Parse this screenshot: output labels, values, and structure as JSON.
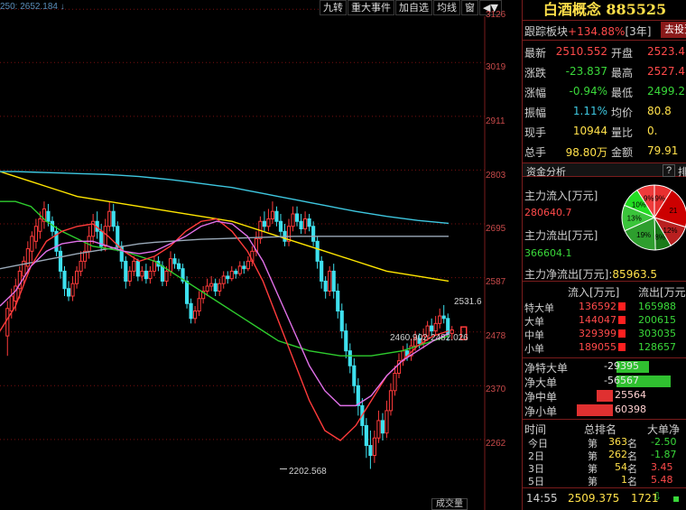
{
  "toolbar": {
    "zoom_text": "250: 2652.184 ↓",
    "items": [
      "九转",
      "重大事件",
      "加自选",
      "均线",
      "窗",
      "◀▼"
    ]
  },
  "y_axis": [
    "3126",
    "3019",
    "2911",
    "2803",
    "2695",
    "2587",
    "2478",
    "2370",
    "2262"
  ],
  "annotations": {
    "high_label": "2531.6",
    "last_value": "2460.902-2482.026",
    "low_label": "2202.568",
    "volume_tab": "成交量"
  },
  "chart_data": {
    "type": "candlestick",
    "ylim": [
      2202,
      3130
    ],
    "y_ticks": [
      3126,
      3019,
      2911,
      2803,
      2695,
      2587,
      2478,
      2370,
      2262
    ],
    "candles": [
      [
        2470,
        2525,
        2430,
        2540
      ],
      [
        2520,
        2550,
        2505,
        2565
      ],
      [
        2540,
        2570,
        2520,
        2585
      ],
      [
        2565,
        2600,
        2545,
        2610
      ],
      [
        2590,
        2620,
        2575,
        2630
      ],
      [
        2610,
        2645,
        2595,
        2660
      ],
      [
        2640,
        2670,
        2620,
        2680
      ],
      [
        2660,
        2690,
        2645,
        2705
      ],
      [
        2680,
        2705,
        2665,
        2720
      ],
      [
        2700,
        2725,
        2685,
        2740
      ],
      [
        2720,
        2700,
        2690,
        2735
      ],
      [
        2700,
        2680,
        2670,
        2710
      ],
      [
        2680,
        2640,
        2630,
        2690
      ],
      [
        2640,
        2600,
        2585,
        2650
      ],
      [
        2600,
        2565,
        2550,
        2610
      ],
      [
        2565,
        2550,
        2540,
        2580
      ],
      [
        2550,
        2575,
        2540,
        2590
      ],
      [
        2575,
        2600,
        2565,
        2610
      ],
      [
        2600,
        2620,
        2590,
        2640
      ],
      [
        2620,
        2640,
        2605,
        2660
      ],
      [
        2640,
        2670,
        2625,
        2690
      ],
      [
        2670,
        2700,
        2655,
        2715
      ],
      [
        2700,
        2680,
        2665,
        2720
      ],
      [
        2680,
        2650,
        2640,
        2695
      ],
      [
        2650,
        2690,
        2640,
        2705
      ],
      [
        2690,
        2720,
        2680,
        2740
      ],
      [
        2720,
        2690,
        2680,
        2735
      ],
      [
        2690,
        2650,
        2640,
        2700
      ],
      [
        2650,
        2620,
        2605,
        2660
      ],
      [
        2620,
        2580,
        2565,
        2630
      ],
      [
        2580,
        2600,
        2570,
        2610
      ],
      [
        2600,
        2620,
        2590,
        2630
      ],
      [
        2620,
        2590,
        2580,
        2625
      ],
      [
        2590,
        2600,
        2580,
        2610
      ],
      [
        2600,
        2585,
        2575,
        2615
      ],
      [
        2585,
        2600,
        2575,
        2610
      ],
      [
        2600,
        2620,
        2590,
        2630
      ],
      [
        2620,
        2610,
        2600,
        2630
      ],
      [
        2610,
        2580,
        2570,
        2620
      ],
      [
        2580,
        2600,
        2570,
        2610
      ],
      [
        2600,
        2625,
        2590,
        2640
      ],
      [
        2625,
        2615,
        2605,
        2635
      ],
      [
        2615,
        2605,
        2600,
        2625
      ],
      [
        2605,
        2580,
        2575,
        2615
      ],
      [
        2580,
        2535,
        2525,
        2590
      ],
      [
        2535,
        2505,
        2495,
        2545
      ],
      [
        2505,
        2520,
        2495,
        2530
      ],
      [
        2520,
        2545,
        2510,
        2560
      ],
      [
        2545,
        2560,
        2535,
        2570
      ],
      [
        2560,
        2570,
        2550,
        2585
      ],
      [
        2570,
        2575,
        2560,
        2590
      ],
      [
        2575,
        2560,
        2550,
        2585
      ],
      [
        2560,
        2575,
        2550,
        2585
      ],
      [
        2575,
        2590,
        2565,
        2600
      ],
      [
        2590,
        2585,
        2575,
        2600
      ],
      [
        2585,
        2600,
        2580,
        2610
      ],
      [
        2600,
        2595,
        2585,
        2605
      ],
      [
        2595,
        2610,
        2590,
        2620
      ],
      [
        2610,
        2605,
        2595,
        2620
      ],
      [
        2605,
        2620,
        2600,
        2630
      ],
      [
        2620,
        2640,
        2610,
        2650
      ],
      [
        2640,
        2665,
        2630,
        2680
      ],
      [
        2665,
        2700,
        2655,
        2710
      ],
      [
        2700,
        2690,
        2680,
        2720
      ],
      [
        2690,
        2705,
        2680,
        2725
      ],
      [
        2705,
        2720,
        2695,
        2740
      ],
      [
        2720,
        2700,
        2690,
        2730
      ],
      [
        2700,
        2680,
        2670,
        2715
      ],
      [
        2680,
        2660,
        2650,
        2695
      ],
      [
        2660,
        2690,
        2650,
        2705
      ],
      [
        2690,
        2715,
        2680,
        2730
      ],
      [
        2715,
        2700,
        2690,
        2730
      ],
      [
        2700,
        2685,
        2675,
        2715
      ],
      [
        2685,
        2705,
        2675,
        2720
      ],
      [
        2705,
        2690,
        2680,
        2715
      ],
      [
        2690,
        2660,
        2650,
        2700
      ],
      [
        2660,
        2620,
        2605,
        2670
      ],
      [
        2620,
        2580,
        2565,
        2630
      ],
      [
        2580,
        2560,
        2545,
        2590
      ],
      [
        2560,
        2600,
        2550,
        2610
      ],
      [
        2600,
        2560,
        2545,
        2615
      ],
      [
        2560,
        2520,
        2505,
        2575
      ],
      [
        2520,
        2480,
        2465,
        2535
      ],
      [
        2480,
        2440,
        2425,
        2495
      ],
      [
        2440,
        2410,
        2395,
        2455
      ],
      [
        2410,
        2370,
        2355,
        2425
      ],
      [
        2370,
        2330,
        2310,
        2385
      ],
      [
        2330,
        2290,
        2270,
        2345
      ],
      [
        2290,
        2250,
        2225,
        2305
      ],
      [
        2250,
        2230,
        2203,
        2280
      ],
      [
        2230,
        2265,
        2215,
        2280
      ],
      [
        2265,
        2300,
        2255,
        2320
      ],
      [
        2300,
        2275,
        2260,
        2315
      ],
      [
        2275,
        2320,
        2265,
        2340
      ],
      [
        2320,
        2360,
        2310,
        2375
      ],
      [
        2360,
        2395,
        2350,
        2410
      ],
      [
        2395,
        2420,
        2385,
        2435
      ],
      [
        2420,
        2440,
        2410,
        2450
      ],
      [
        2440,
        2430,
        2420,
        2455
      ],
      [
        2430,
        2450,
        2420,
        2465
      ],
      [
        2450,
        2465,
        2440,
        2480
      ],
      [
        2465,
        2455,
        2445,
        2475
      ],
      [
        2455,
        2470,
        2445,
        2485
      ],
      [
        2470,
        2490,
        2460,
        2500
      ],
      [
        2490,
        2480,
        2470,
        2505
      ],
      [
        2480,
        2495,
        2470,
        2510
      ],
      [
        2495,
        2510,
        2485,
        2525
      ],
      [
        2510,
        2505,
        2495,
        2532
      ],
      [
        2505,
        2475,
        2460,
        2515
      ],
      [
        2475,
        2482,
        2461,
        2490
      ]
    ],
    "ma_lines": [
      {
        "color": "#ffe600",
        "values": [
          2800,
          2790,
          2780,
          2770,
          2760,
          2750,
          2745,
          2740,
          2735,
          2730,
          2725,
          2720,
          2715,
          2710,
          2705,
          2700,
          2690,
          2680,
          2670,
          2660,
          2650,
          2640,
          2630,
          2620,
          2610,
          2600,
          2595,
          2590,
          2585,
          2580
        ]
      },
      {
        "color": "#3ec7e0",
        "values": [
          2800,
          2800,
          2799,
          2798,
          2797,
          2796,
          2795,
          2794,
          2792,
          2790,
          2787,
          2784,
          2780,
          2776,
          2772,
          2768,
          2762,
          2756,
          2750,
          2744,
          2738,
          2732,
          2726,
          2720,
          2715,
          2710,
          2706,
          2702,
          2699,
          2696
        ]
      },
      {
        "color": "#9aa9b8",
        "values": [
          2605,
          2611,
          2617,
          2623,
          2629,
          2635,
          2640,
          2645,
          2650,
          2655,
          2658,
          2660,
          2662,
          2664,
          2665,
          2666,
          2667,
          2668,
          2669,
          2670,
          2670,
          2670,
          2670,
          2670,
          2670,
          2670,
          2670,
          2670,
          2670,
          2670
        ]
      },
      {
        "color": "#2ecc2e",
        "values": [
          2740,
          2740,
          2730,
          2700,
          2680,
          2665,
          2650,
          2645,
          2640,
          2630,
          2620,
          2600,
          2580,
          2560,
          2540,
          2520,
          2500,
          2480,
          2460,
          2450,
          2440,
          2435,
          2430,
          2430,
          2430,
          2435,
          2440,
          2450,
          2460,
          2470
        ]
      },
      {
        "color": "#ff3b3b",
        "values": [
          2480,
          2530,
          2610,
          2660,
          2680,
          2690,
          2695,
          2670,
          2640,
          2620,
          2630,
          2650,
          2680,
          2700,
          2705,
          2680,
          2640,
          2580,
          2500,
          2420,
          2340,
          2280,
          2260,
          2290,
          2340,
          2390,
          2420,
          2450,
          2470,
          2480
        ]
      },
      {
        "color": "#e070e8",
        "values": [
          2530,
          2560,
          2610,
          2640,
          2655,
          2660,
          2660,
          2650,
          2640,
          2635,
          2640,
          2655,
          2670,
          2690,
          2700,
          2695,
          2670,
          2620,
          2550,
          2480,
          2410,
          2360,
          2330,
          2330,
          2350,
          2390,
          2420,
          2440,
          2460,
          2475
        ]
      }
    ]
  },
  "panel": {
    "title": "白酒概念 885525",
    "track_label": "跟踪板块",
    "track_value": "+134.88%",
    "track_period": "[3年]",
    "goto_btn": "去投资",
    "quote": [
      {
        "l1": "最新",
        "v1": "2510.552",
        "l2": "开盘",
        "v2": "2523.4",
        "c1": "#ff4a4a",
        "c2": "#ff4a4a"
      },
      {
        "l1": "涨跌",
        "v1": "-23.837",
        "l2": "最高",
        "v2": "2527.4",
        "c1": "#3ad93a",
        "c2": "#ff4a4a"
      },
      {
        "l1": "涨幅",
        "v1": "-0.94%",
        "l2": "最低",
        "v2": "2499.2",
        "c1": "#3ad93a",
        "c2": "#3ad93a"
      },
      {
        "l1": "振幅",
        "v1": "1.11%",
        "l2": "均价",
        "v2": "80.8",
        "c1": "#3ec7e0",
        "c2": "#ffe04a"
      },
      {
        "l1": "现手",
        "v1": "10944",
        "l2": "量比",
        "v2": "0.",
        "c1": "#ffe04a",
        "c2": "#ffe04a"
      },
      {
        "l1": "总手",
        "v1": "98.80万",
        "l2": "金额",
        "v2": "79.91",
        "c1": "#ffe04a",
        "c2": "#ffe04a"
      }
    ],
    "fund_tab": "资金分析",
    "fund_q": "?",
    "fund_row": "排",
    "inflow_label": "主力流入[万元]",
    "inflow_value": "280640.7",
    "outflow_label": "主力流出[万元]",
    "outflow_value": "366604.1",
    "net_label": "主力净流出[万元]:",
    "net_value": "85963.5",
    "pie": [
      {
        "label": "9%",
        "value": 9,
        "color": "#e83030"
      },
      {
        "label": "21",
        "value": 21,
        "color": "#cc0000"
      },
      {
        "label": "12%",
        "value": 12,
        "color": "#b82020"
      },
      {
        "label": "8%",
        "value": 8,
        "color": "#1a7a1a"
      },
      {
        "label": "19%",
        "value": 19,
        "color": "#2e9e2e"
      },
      {
        "label": "13%",
        "value": 13,
        "color": "#3ac43a"
      },
      {
        "label": "10%",
        "value": 10,
        "color": "#22dd22"
      },
      {
        "label": "9%",
        "value": 9,
        "color": "#ee3b3b"
      }
    ],
    "flow_headers": [
      "流入[万元]",
      "流出[万元]"
    ],
    "flows": [
      {
        "label": "特大单",
        "inflow": "136592",
        "outflow": "165988"
      },
      {
        "label": "大单",
        "inflow": "144047",
        "outflow": "200615"
      },
      {
        "label": "中单",
        "inflow": "329399",
        "outflow": "303035"
      },
      {
        "label": "小单",
        "inflow": "189055",
        "outflow": "128657"
      }
    ],
    "net_rows": [
      {
        "label": "净特大单",
        "value": "-29395",
        "color": "#3ad93a",
        "bar": 0.6
      },
      {
        "label": "净大单",
        "value": "-56567",
        "color": "#3ad93a",
        "bar": 1.0
      },
      {
        "label": "净中单",
        "value": "25564",
        "color": "#ff4a4a",
        "bar": 0.45
      },
      {
        "label": "净小单",
        "value": "60398",
        "color": "#ff4a4a",
        "bar": 1.0
      }
    ],
    "rank_headers": [
      "时间",
      "总排名",
      "大单净"
    ],
    "ranks": [
      {
        "t": "今日",
        "pre": "第",
        "n": "363",
        "suf": "名",
        "v": "-2.50",
        "vc": "#3ad93a"
      },
      {
        "t": "2日",
        "pre": "第",
        "n": "262",
        "suf": "名",
        "v": "-1.87",
        "vc": "#3ad93a"
      },
      {
        "t": "3日",
        "pre": "第",
        "n": "54",
        "suf": "名",
        "v": "3.45",
        "vc": "#ff4a4a"
      },
      {
        "t": "5日",
        "pre": "第",
        "n": "1",
        "suf": "名",
        "v": "5.48",
        "vc": "#ff4a4a"
      }
    ],
    "footer": {
      "time": "14:55",
      "price": "2509.375",
      "vol": "1721"
    }
  }
}
